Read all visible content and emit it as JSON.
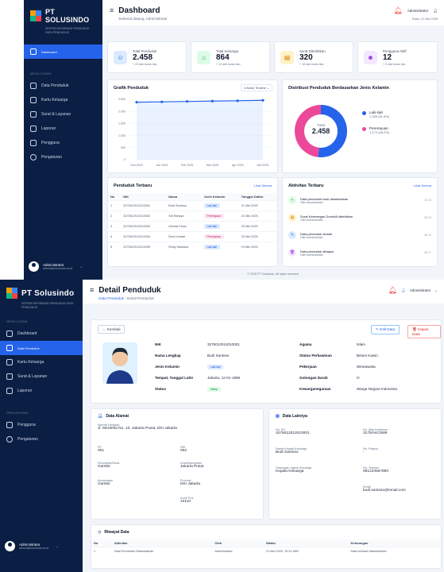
{
  "brand": {
    "name1": "PT SOLUSINDO",
    "sub1": "SISTEM INFORMASI PENDUDUK DATA PENDUDUK",
    "name2": "PT Solusindo",
    "sub2": "SISTEM INFORMASI PENDUDUK DATA PENDUDUK"
  },
  "menu": {
    "dashboard": "Dashboard",
    "section1": "MENU UTAMA",
    "penduduk": "Data Penduduk",
    "kk": "Kartu Keluarga",
    "surat": "Surat & Layanan",
    "laporan": "Laporan",
    "section2": "PENGATURAN",
    "pengguna": "Pengguna",
    "pengaturan": "Pengaturan"
  },
  "user": {
    "name": "Administrator",
    "email": "admin@solusindo.co.id"
  },
  "dash": {
    "title": "Dashboard",
    "subtitle": "Selamat datang, Administrator",
    "topuser": "Administrator",
    "date": "Rabu, 21 Mei 2025",
    "stats": [
      {
        "label": "Total Penduduk",
        "value": "2.458",
        "sub": "+ 23 dari bulan lalu"
      },
      {
        "label": "Total Keluarga",
        "value": "864",
        "sub": "+ 12 dari bulan lalu"
      },
      {
        "label": "Surat Diterbitkan",
        "value": "320",
        "sub": "+ 18 dari bulan lalu"
      },
      {
        "label": "Pengguna Aktif",
        "value": "12",
        "sub": "+ 2 dari bulan lalu"
      }
    ],
    "grafik_title": "Grafik Penduduk",
    "grafik_select": "6 Bulan Terakhir",
    "dist_title": "Distribusi Penduduk Berdasarkan Jenis Kelamin",
    "donut": {
      "center_label": "Total",
      "center_value": "2.458",
      "legend": [
        {
          "label": "Laki-laki",
          "value": "1.285 (51.8%)"
        },
        {
          "label": "Perempuan",
          "value": "1.173 (48.2%)"
        }
      ]
    },
    "table_title": "Penduduk Terbaru",
    "table_link": "Lihat Semua",
    "table_head": [
      "No",
      "NIK",
      "Nama",
      "Jenis Kelamin",
      "Tanggal Daftar"
    ],
    "table_rows": [
      [
        "1",
        "3275012012010001",
        "Budi Santoso",
        "Laki-laki",
        "21 Mei 2025"
      ],
      [
        "2",
        "3275012012010002",
        "Siti Rahayu",
        "Perempuan",
        "21 Mei 2025"
      ],
      [
        "3",
        "3275012012010003",
        "Ahmad Fauzi",
        "Laki-laki",
        "20 Mei 2025"
      ],
      [
        "4",
        "3275012012010004",
        "Dewi Lestari",
        "Perempuan",
        "20 Mei 2025"
      ],
      [
        "5",
        "3275012012010005",
        "Rizky Maulana",
        "Laki-laki",
        "19 Mei 2025"
      ]
    ],
    "act_title": "Aktivitas Terbaru",
    "act_link": "Lihat Semua",
    "activities": [
      {
        "t": "Data penduduk baru ditambahkan",
        "s": "Oleh Administrator",
        "time": "10:24"
      },
      {
        "t": "Surat Keterangan Domisili diterbitkan",
        "s": "Oleh Administrator",
        "time": "09:15"
      },
      {
        "t": "Data penduduk diubah",
        "s": "Oleh Administrator",
        "time": "08:15"
      },
      {
        "t": "Data penduduk dihapus",
        "s": "Oleh Administrator",
        "time": "08:17"
      }
    ],
    "footer": "© 2025 PT Solusindo. All rights reserved."
  },
  "chart_data": {
    "type": "line",
    "x": [
      "Des 2024",
      "Jan 2025",
      "Feb 2025",
      "Mar 2025",
      "Apr 2025",
      "Mei 2025"
    ],
    "series": [
      {
        "values": [
          2380,
          2395,
          2412,
          2425,
          2440,
          2458
        ]
      }
    ],
    "ylim": [
      0,
      2500
    ],
    "yticks": [
      "0",
      "500",
      "1.000",
      "1.500",
      "2.000",
      "2.500"
    ],
    "grid": true
  },
  "donut_data": {
    "type": "pie",
    "categories": [
      "Laki-laki",
      "Perempuan"
    ],
    "values": [
      51.8,
      48.2
    ],
    "colors": [
      "#2563eb",
      "#ec4899"
    ]
  },
  "detail": {
    "title": "Detail Penduduk",
    "crumb1": "Data Penduduk",
    "crumb2": "Detail Penduduk",
    "back": "← Kembali",
    "edit": "Edit Data",
    "hapus": "Hapus Data",
    "left": [
      [
        "NIK",
        "3275012012010001"
      ],
      [
        "Nama Lengkap",
        "Budi Santoso"
      ],
      [
        "Jenis Kelamin",
        "Laki-laki"
      ],
      [
        "Tempat, Tanggal Lahir",
        "Jakarta, 12-01-1989"
      ],
      [
        "Status",
        "Hidup"
      ]
    ],
    "right": [
      [
        "Agama",
        "Islam"
      ],
      [
        "Status Perkawinan",
        "Belum Kawin"
      ],
      [
        "Pekerjaan",
        "Wiraswasta"
      ],
      [
        "Golongan Darah",
        "O"
      ],
      [
        "Kewarganegaraan",
        "Warga Negara Indonesia"
      ]
    ],
    "alamat_title": "Data Alamat",
    "alamat": {
      "l_alamat": "Alamat Lengkap",
      "alamat": "Jl. Merdeka No. 10, Jakarta Pusat, DKI Jakarta",
      "l_rt": "RT",
      "rt": "001",
      "l_rw": "RW",
      "rw": "002",
      "l_kel": "Kelurahan/Desa",
      "kel": "Gambir",
      "l_kab": "Kota/Kabupaten",
      "kab": "Jakarta Pusat",
      "l_kec": "Kecamatan",
      "kec": "Gambir",
      "l_prov": "Provinsi",
      "prov": "DKI Jakarta",
      "l_pos": "Kode Pos",
      "pos": "10110"
    },
    "lain_title": "Data Lainnya",
    "lain": {
      "l_kk": "No. KK",
      "kk": "3275012012010001",
      "l_akta": "No. Akta Kelahiran",
      "akta": "3175/AK/1989",
      "l_kepala": "Nama Kepala Keluarga",
      "kepala": "Budi Santoso",
      "l_paspor": "No. Paspor",
      "paspor": "-",
      "l_hub": "Hubungan dalam Keluarga",
      "hub": "Kepala Keluarga",
      "l_telp": "No. Telepon",
      "telp": "081234567890",
      "l_email": "Email",
      "email": "budi.santoso@email.com"
    },
    "riwayat_title": "Riwayat Data",
    "riwayat_head": [
      "No",
      "Aktivitas",
      "Oleh",
      "Waktu",
      "Keterangan"
    ],
    "riwayat_row": [
      "1",
      "Data Penduduk Ditambahkan",
      "Administrator",
      "21 Mei 2025, 10:24 WIB",
      "Data berhasil ditambahkan"
    ]
  }
}
